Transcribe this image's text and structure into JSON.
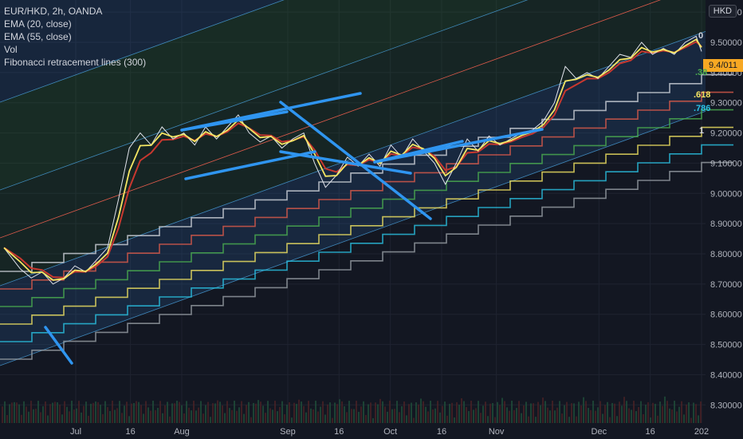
{
  "legend": {
    "symbol": "EUR/HKD, 2h, OANDA",
    "ema20": "EMA (20, close)",
    "ema55": "EMA (55, close)",
    "vol": "Vol",
    "fib": "Fibonacci retracement lines (300)"
  },
  "currency_button": "HKD",
  "last_price_tag": "9.4/011",
  "fib_labels": [
    "0",
    ".38",
    ".618",
    ".786",
    "1"
  ],
  "colors": {
    "background": "#131722",
    "ema20": "#f5e663",
    "ema55": "#c8382f",
    "price": "#e0e3eb",
    "trendlines": "#2f95f0",
    "price_tag": "#f7a823"
  },
  "chart_data": {
    "type": "line",
    "title": "EUR/HKD, 2h, OANDA",
    "xlabel": "",
    "ylabel": "",
    "x_ticks": [
      "Jul",
      "16",
      "Aug",
      "Sep",
      "16",
      "Oct",
      "16",
      "Nov",
      "Dec",
      "16",
      "202"
    ],
    "y_ticks": [
      "9.60000",
      "9.50000",
      "9.40000",
      "9.30000",
      "9.20000",
      "9.10000",
      "9.00000",
      "8.90000",
      "8.80000",
      "8.70000",
      "8.60000",
      "8.50000",
      "8.40000",
      "8.30000"
    ],
    "ylim": [
      8.24,
      9.64
    ],
    "grid": true,
    "x_domain_days": [
      -1,
      125
    ],
    "y_axis_side": "right",
    "series": [
      {
        "name": "Price",
        "x_days": [
          -3,
          0,
          2,
          4,
          6,
          8,
          10,
          12,
          14,
          16,
          18,
          20,
          22,
          24,
          26,
          28,
          30,
          32,
          34,
          36,
          38,
          40,
          42,
          44,
          46,
          48,
          50,
          52,
          54,
          56,
          58,
          60,
          62,
          64,
          66,
          68,
          70,
          72,
          74,
          76,
          78,
          80,
          82,
          84,
          86,
          88,
          90,
          92,
          94,
          96,
          98,
          100,
          102,
          104,
          106,
          108,
          110,
          112,
          114,
          116,
          118,
          120,
          122,
          124,
          125
        ],
        "values": [
          8.82,
          8.75,
          8.72,
          8.74,
          8.7,
          8.72,
          8.76,
          8.74,
          8.78,
          8.82,
          8.98,
          9.15,
          9.2,
          9.16,
          9.22,
          9.18,
          9.2,
          9.16,
          9.22,
          9.18,
          9.22,
          9.26,
          9.2,
          9.17,
          9.19,
          9.15,
          9.18,
          9.2,
          9.1,
          9.02,
          9.06,
          9.12,
          9.09,
          9.13,
          9.09,
          9.16,
          9.12,
          9.18,
          9.14,
          9.1,
          9.03,
          9.1,
          9.18,
          9.14,
          9.19,
          9.16,
          9.18,
          9.2,
          9.21,
          9.24,
          9.3,
          9.42,
          9.38,
          9.4,
          9.38,
          9.42,
          9.46,
          9.45,
          9.5,
          9.46,
          9.48,
          9.46,
          9.5,
          9.52,
          9.47
        ]
      }
    ]
  }
}
